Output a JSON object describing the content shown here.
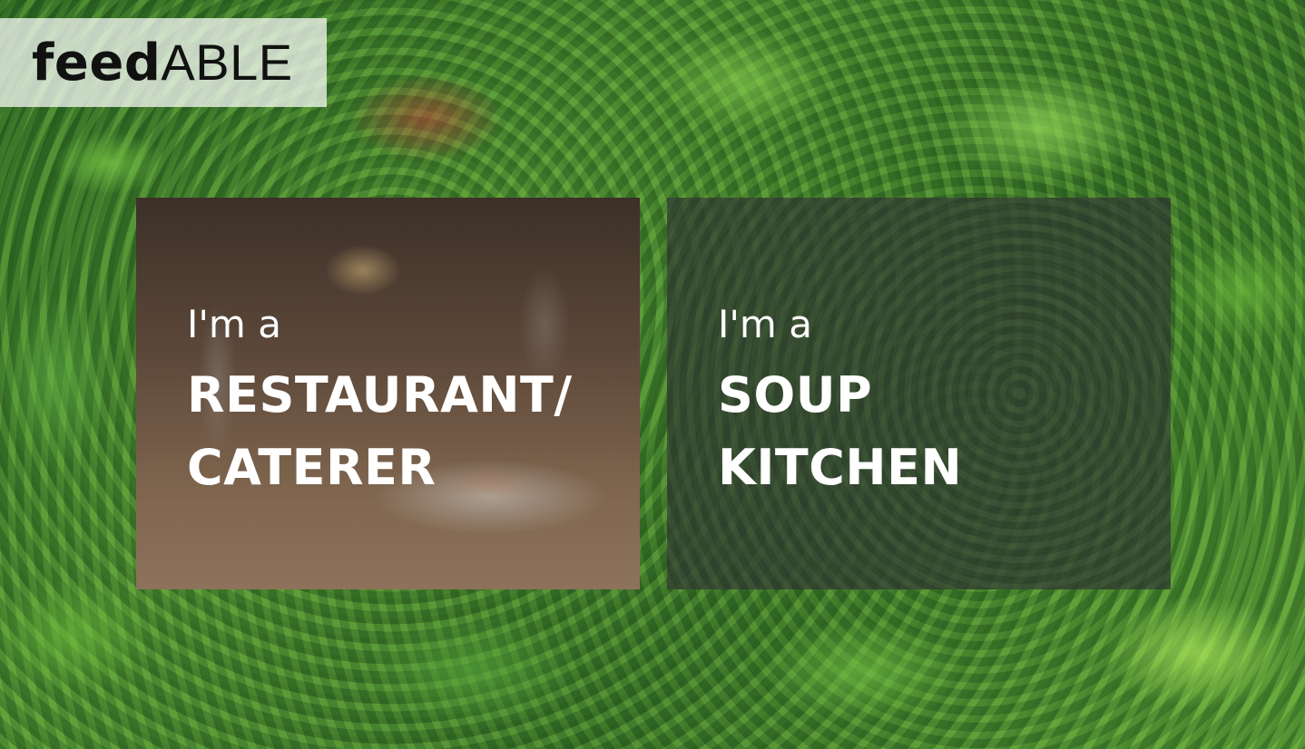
{
  "logo": {
    "bold_part": "feed",
    "light_part": "ABLE"
  },
  "cards": [
    {
      "pre_text": "I'm a",
      "line1": "RESTAURANT/",
      "line2": "CATERER"
    },
    {
      "pre_text": "I'm a",
      "line1": "SOUP",
      "line2": "KITCHEN"
    }
  ],
  "colors": {
    "card_text": "#ffffff",
    "logo_text": "#111111",
    "logo_box_bg": "rgba(255,255,255,0.72)"
  }
}
